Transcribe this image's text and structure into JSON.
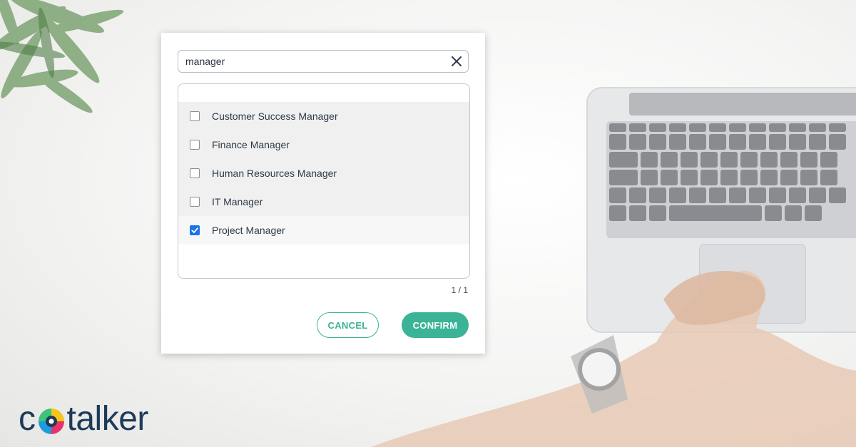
{
  "search": {
    "value": "manager"
  },
  "options": [
    {
      "label": "Customer Success Manager",
      "checked": false
    },
    {
      "label": "Finance Manager",
      "checked": false
    },
    {
      "label": "Human Resources Manager",
      "checked": false
    },
    {
      "label": "IT Manager",
      "checked": false
    },
    {
      "label": "Project Manager",
      "checked": true
    }
  ],
  "counter": "1 / 1",
  "buttons": {
    "cancel": "CANCEL",
    "confirm": "CONFIRM"
  },
  "logo": {
    "text_start": "c",
    "text_end": "talker"
  },
  "icons": {
    "clear": "close-icon",
    "check": "checkmark-icon",
    "logo_mark": "cotalker-logo-mark"
  },
  "colors": {
    "accent": "#3bb396",
    "checkbox_checked": "#1a73e8",
    "logo_text": "#1d3b5a"
  }
}
